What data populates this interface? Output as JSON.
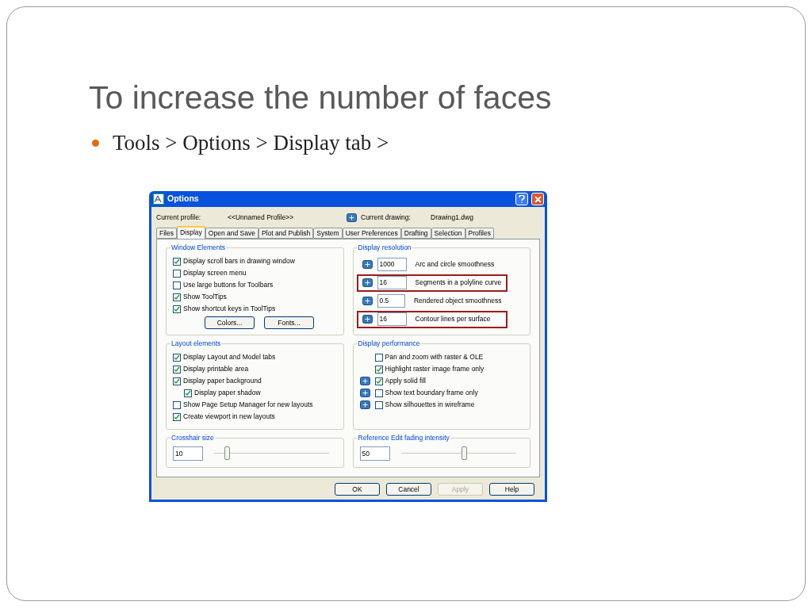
{
  "slide": {
    "title": "To increase the number of faces",
    "bullet": "Tools > Options > Display tab >"
  },
  "dialog": {
    "title": "Options",
    "profile_label": "Current profile:",
    "profile_value": "<<Unnamed Profile>>",
    "drawing_label": "Current drawing:",
    "drawing_value": "Drawing1.dwg",
    "tabs": [
      {
        "label": "Files",
        "selected": false
      },
      {
        "label": "Display",
        "selected": true
      },
      {
        "label": "Open and Save",
        "selected": false
      },
      {
        "label": "Plot and Publish",
        "selected": false
      },
      {
        "label": "System",
        "selected": false
      },
      {
        "label": "User Preferences",
        "selected": false
      },
      {
        "label": "Drafting",
        "selected": false
      },
      {
        "label": "Selection",
        "selected": false
      },
      {
        "label": "Profiles",
        "selected": false
      }
    ],
    "window_elements": {
      "title": "Window Elements",
      "checkboxes": [
        {
          "label": "Display scroll bars in drawing window",
          "checked": true
        },
        {
          "label": "Display screen menu",
          "checked": false
        },
        {
          "label": "Use large buttons for Toolbars",
          "checked": false
        },
        {
          "label": "Show ToolTips",
          "checked": true
        },
        {
          "label": "Show shortcut keys in ToolTips",
          "checked": true
        }
      ],
      "buttons": [
        "Colors...",
        "Fonts..."
      ]
    },
    "display_resolution": {
      "title": "Display resolution",
      "rows": [
        {
          "value": "1000",
          "label": "Arc and circle smoothness",
          "highlighted": false
        },
        {
          "value": "16",
          "label": "Segments in a polyline curve",
          "highlighted": true
        },
        {
          "value": "0.5",
          "label": "Rendered object smoothness",
          "highlighted": false
        },
        {
          "value": "16",
          "label": "Contour lines per surface",
          "highlighted": true
        }
      ]
    },
    "layout_elements": {
      "title": "Layout elements",
      "checkboxes": [
        {
          "label": "Display Layout and Model tabs",
          "checked": true
        },
        {
          "label": "Display printable area",
          "checked": true
        },
        {
          "label": "Display paper background",
          "checked": true,
          "children": [
            {
              "label": "Display paper shadow",
              "checked": true
            }
          ]
        },
        {
          "label": "Show Page Setup Manager for new layouts",
          "checked": false
        },
        {
          "label": "Create viewport in new layouts",
          "checked": true
        }
      ]
    },
    "display_performance": {
      "title": "Display performance",
      "rows": [
        {
          "label": "Pan and zoom with raster & OLE",
          "checked": false,
          "saved_in_drawing": false
        },
        {
          "label": "Highlight raster image frame only",
          "checked": true,
          "saved_in_drawing": false
        },
        {
          "label": "Apply solid fill",
          "checked": true,
          "saved_in_drawing": true
        },
        {
          "label": "Show text boundary frame only",
          "checked": false,
          "saved_in_drawing": true
        },
        {
          "label": "Show silhouettes in wireframe",
          "checked": false,
          "saved_in_drawing": true
        }
      ]
    },
    "crosshair": {
      "title": "Crosshair size",
      "value": "10",
      "level": 0.11
    },
    "fading": {
      "title": "Reference Edit fading intensity",
      "value": "50",
      "level": 0.55
    },
    "buttons": [
      {
        "label": "OK",
        "disabled": false
      },
      {
        "label": "Cancel",
        "disabled": false
      },
      {
        "label": "Apply",
        "disabled": true
      },
      {
        "label": "Help",
        "disabled": false
      }
    ]
  }
}
